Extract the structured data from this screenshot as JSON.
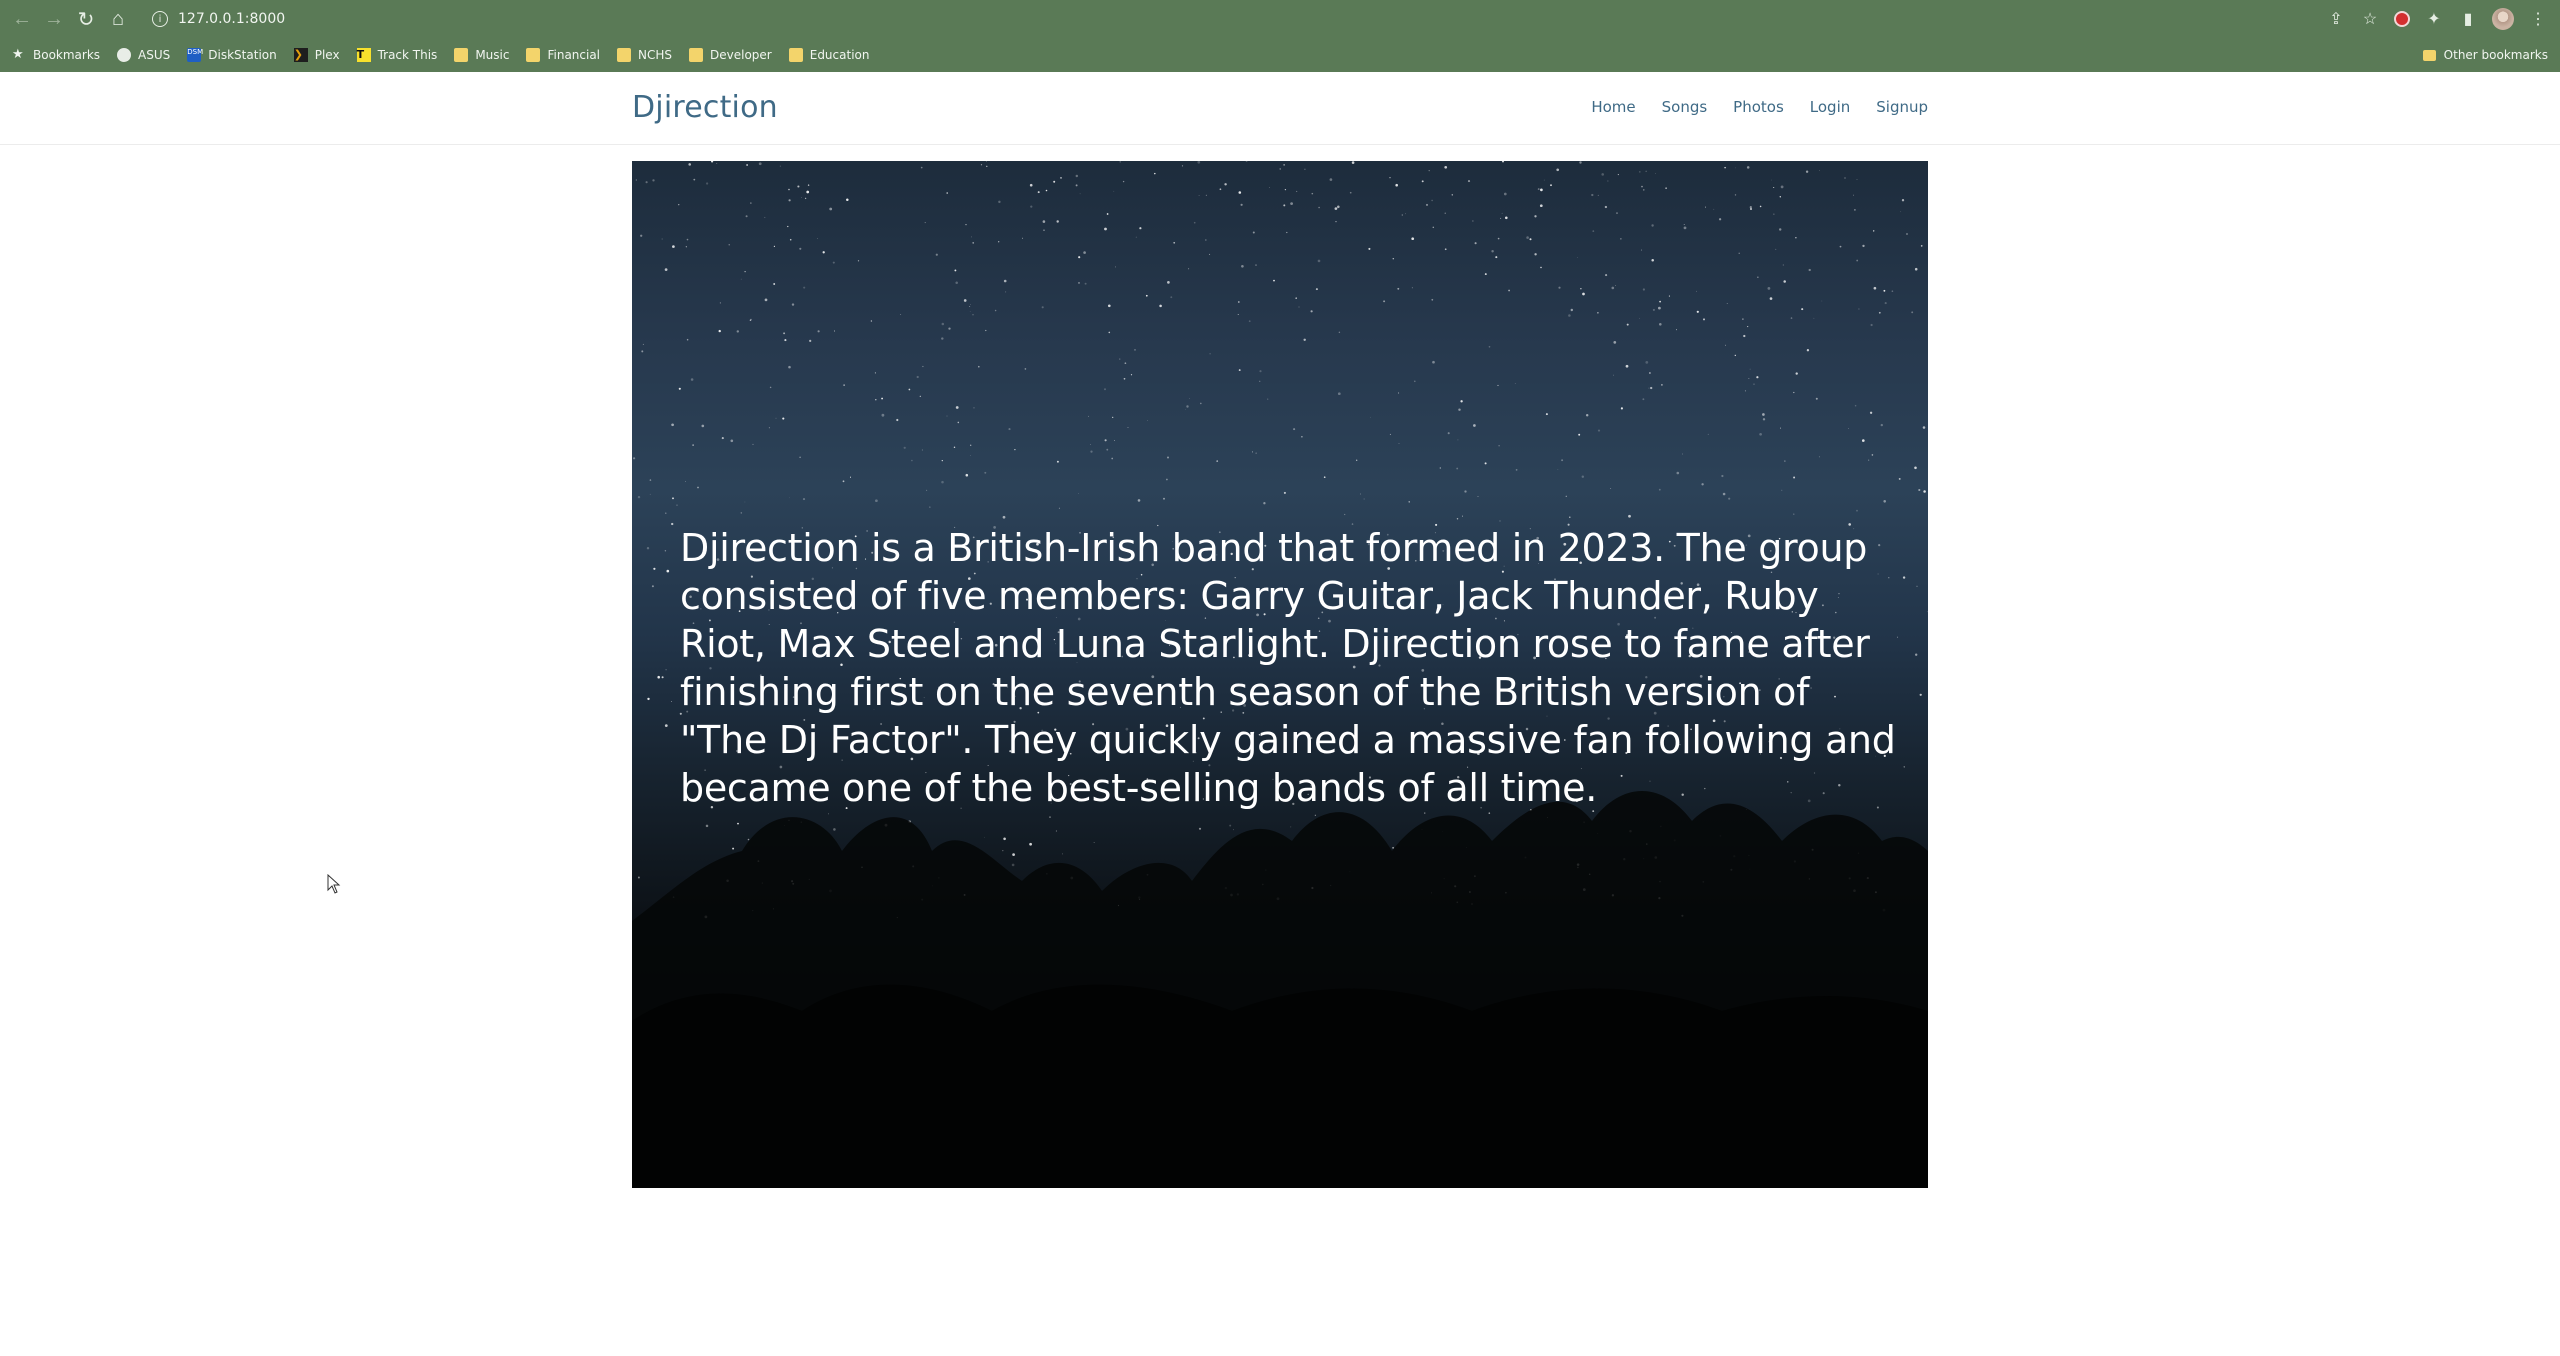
{
  "browser": {
    "url": "127.0.0.1:8000",
    "bookmarks": [
      {
        "label": "Bookmarks",
        "icon": "star-icon"
      },
      {
        "label": "ASUS",
        "icon": "asus-icon"
      },
      {
        "label": "DiskStation",
        "icon": "diskstation-icon"
      },
      {
        "label": "Plex",
        "icon": "plex-icon"
      },
      {
        "label": "Track This",
        "icon": "track-this-icon"
      },
      {
        "label": "Music",
        "icon": "folder-icon"
      },
      {
        "label": "Financial",
        "icon": "folder-icon"
      },
      {
        "label": "NCHS",
        "icon": "folder-icon"
      },
      {
        "label": "Developer",
        "icon": "folder-icon"
      },
      {
        "label": "Education",
        "icon": "folder-icon"
      }
    ],
    "other_bookmarks": "Other bookmarks"
  },
  "site": {
    "brand": "Djirection",
    "nav": [
      "Home",
      "Songs",
      "Photos",
      "Login",
      "Signup"
    ],
    "hero_text": "Djirection is a British-Irish band that formed in 2023. The group consisted of five members: Garry Guitar, Jack Thunder, Ruby Riot, Max Steel and Luna Starlight. Djirection rose to fame after finishing first on the seventh season of the British version of \"The Dj Factor\". They quickly gained a massive fan following and became one of the best-selling bands of all time."
  },
  "colors": {
    "chrome": "#5a7a56",
    "brand": "#3f6a86"
  }
}
